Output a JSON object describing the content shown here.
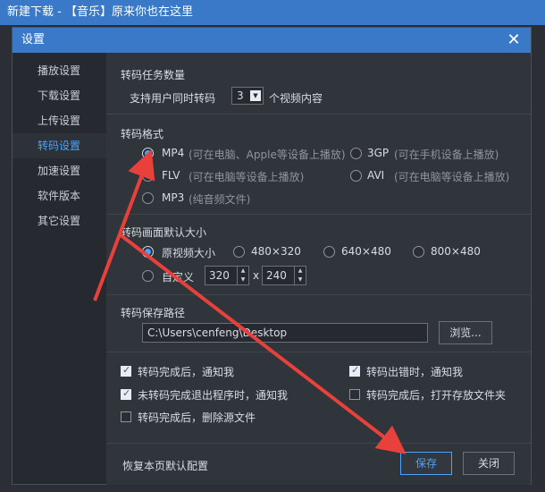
{
  "outer_window": {
    "title": "新建下载 - 【音乐】原来你也在这里"
  },
  "dialog": {
    "title": "设置",
    "sidebar": {
      "items": [
        {
          "label": "播放设置"
        },
        {
          "label": "下载设置"
        },
        {
          "label": "上传设置"
        },
        {
          "label": "转码设置"
        },
        {
          "label": "加速设置"
        },
        {
          "label": "软件版本"
        },
        {
          "label": "其它设置"
        }
      ],
      "active_index": 3
    },
    "task_count": {
      "title": "转码任务数量",
      "prefix": "支持用户同时转码",
      "value": "3",
      "suffix": "个视频内容"
    },
    "format": {
      "title": "转码格式",
      "options": [
        {
          "name": "MP4",
          "desc": "(可在电脑、Apple等设备上播放)",
          "selected": true
        },
        {
          "name": "3GP",
          "desc": "(可在手机设备上播放)",
          "selected": false
        },
        {
          "name": "FLV",
          "desc": "(可在电脑等设备上播放)",
          "selected": false
        },
        {
          "name": "AVI",
          "desc": "(可在电脑等设备上播放)",
          "selected": false
        },
        {
          "name": "MP3",
          "desc": "(纯音频文件)",
          "selected": false
        }
      ]
    },
    "resolution": {
      "title": "转码画面默认大小",
      "options": [
        {
          "label": "原视频大小",
          "selected": true
        },
        {
          "label": "480×320",
          "selected": false
        },
        {
          "label": "640×480",
          "selected": false
        },
        {
          "label": "800×480",
          "selected": false
        }
      ],
      "custom_label": "自定义",
      "custom_width": "320",
      "custom_height": "240",
      "times": "x"
    },
    "save_path": {
      "title": "转码保存路径",
      "value": "C:\\Users\\cenfeng\\Desktop",
      "browse_label": "浏览..."
    },
    "notifications": [
      {
        "label": "转码完成后，通知我",
        "checked": true
      },
      {
        "label": "转码出错时，通知我",
        "checked": true
      },
      {
        "label": "未转码完成退出程序时，通知我",
        "checked": true
      },
      {
        "label": "转码完成后，打开存放文件夹",
        "checked": false
      },
      {
        "label": "转码完成后，删除源文件",
        "checked": false
      }
    ],
    "footer": {
      "reset_label": "恢复本页默认配置",
      "save_label": "保存",
      "close_label": "关闭"
    }
  },
  "colors": {
    "accent": "#4aa3ff",
    "titlebar": "#3a79c8",
    "annotation_arrow": "#e8413b"
  },
  "annotations": [
    {
      "type": "arrow-up"
    },
    {
      "type": "arrow-down"
    }
  ]
}
